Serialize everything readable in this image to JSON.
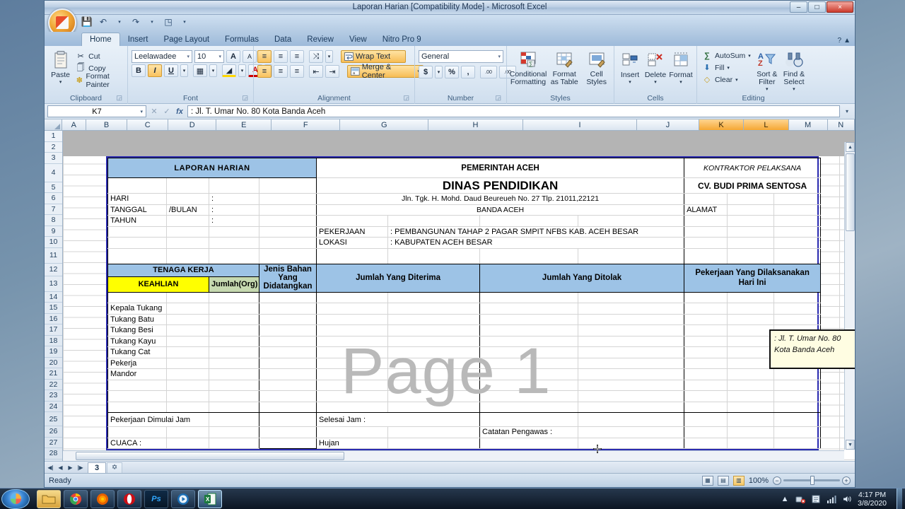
{
  "window": {
    "title": "Laporan Harian  [Compatibility Mode] - Microsoft Excel",
    "minimize": "–",
    "maximize": "□",
    "close": "×",
    "help": "?",
    "ribbon_collapse": "▲"
  },
  "qat": {
    "save": "save-icon",
    "undo": "↶",
    "redo": "↷",
    "print_preview": "◳",
    "customize": "▾"
  },
  "tabs": [
    {
      "label": "Home",
      "active": true
    },
    {
      "label": "Insert",
      "active": false
    },
    {
      "label": "Page Layout",
      "active": false
    },
    {
      "label": "Formulas",
      "active": false
    },
    {
      "label": "Data",
      "active": false
    },
    {
      "label": "Review",
      "active": false
    },
    {
      "label": "View",
      "active": false
    },
    {
      "label": "Nitro Pro 9",
      "active": false
    }
  ],
  "ribbon": {
    "clipboard": {
      "label": "Clipboard",
      "paste": "Paste",
      "cut": "Cut",
      "copy": "Copy",
      "format_painter": "Format Painter",
      "dialog": "◲"
    },
    "font": {
      "label": "Font",
      "family": "Leelawadee",
      "size": "10",
      "grow": "A",
      "shrink": "A",
      "bold": "B",
      "italic": "I",
      "underline": "U",
      "borders": "▦",
      "fill_color": "◢",
      "font_color": "A",
      "dialog": "◲"
    },
    "alignment": {
      "label": "Alignment",
      "align_top": "≡",
      "align_middle": "≡",
      "align_bottom": "≡",
      "orientation": "⤨",
      "align_left": "≡",
      "align_center": "≡",
      "align_right": "≡",
      "decrease_indent": "⇤",
      "increase_indent": "⇥",
      "wrap_text": "Wrap Text",
      "merge_center": "Merge & Center",
      "merge_caret": "▾",
      "dialog": "◲"
    },
    "number": {
      "label": "Number",
      "format": "General",
      "currency": "$",
      "percent": "%",
      "comma": ",",
      "increase_decimal": ".00",
      "decrease_decimal": ".00",
      "dialog": "◲"
    },
    "styles": {
      "label": "Styles",
      "conditional_formatting": "Conditional Formatting",
      "format_as_table": "Format as Table",
      "cell_styles": "Cell Styles"
    },
    "cells": {
      "label": "Cells",
      "insert": "Insert",
      "delete": "Delete",
      "format": "Format"
    },
    "editing": {
      "label": "Editing",
      "autosum": "AutoSum",
      "fill": "Fill",
      "clear": "Clear",
      "sort_filter": "Sort & Filter",
      "find_select": "Find & Select"
    }
  },
  "formula_bar": {
    "name_box": "K7",
    "cancel": "✕",
    "enter": "✓",
    "insert_function": "fx",
    "value": ": Jl. T. Umar No. 80 Kota Banda Aceh",
    "expand": "▾"
  },
  "grid": {
    "columns": [
      "A",
      "B",
      "C",
      "D",
      "E",
      "F",
      "G",
      "H",
      "I",
      "J",
      "K",
      "L",
      "M",
      "N"
    ],
    "selected_columns": [
      "K",
      "L"
    ],
    "rows": [
      "1",
      "2",
      "3",
      "4",
      "5",
      "6",
      "7",
      "8",
      "9",
      "10",
      "11",
      "12",
      "13",
      "14",
      "15",
      "16",
      "17",
      "18",
      "19",
      "20",
      "21",
      "22",
      "23",
      "24",
      "25",
      "26",
      "27",
      "28"
    ],
    "watermark": "Page 1"
  },
  "form": {
    "title": "LAPORAN HARIAN",
    "left": {
      "hari_label": "HARI",
      "hari_sep": ":",
      "tanggal_label": "TANGGAL",
      "bulan_label": "/BULAN",
      "tanggal_sep": ":",
      "tahun_label": "TAHUN",
      "tahun_sep": ":"
    },
    "center": {
      "line1": "PEMERINTAH ACEH",
      "line2": "DINAS PENDIDIKAN",
      "line3": "Jln. Tgk. H. Mohd. Daud Beureueh No. 27 Tlp. 21011,22121",
      "line4": "BANDA ACEH",
      "pekerjaan_label": "PEKERJAAN",
      "pekerjaan_value": ": PEMBANGUNAN TAHAP 2 PAGAR SMPIT NFBS KAB. ACEH BESAR",
      "lokasi_label": "LOKASI",
      "lokasi_value": ": KABUPATEN ACEH BESAR"
    },
    "right": {
      "kontraktor_label": "KONTRAKTOR PELAKSANA",
      "kontraktor_name": "CV. BUDI PRIMA SENTOSA",
      "alamat_label": "ALAMAT",
      "alamat_value": ": Jl. T. Umar No. 80\nKota Banda Aceh"
    },
    "table": {
      "tenaga_kerja": "TENAGA KERJA",
      "keahlian": "KEAHLIAN",
      "jumlah_org": "Jumlah(Org)",
      "jenis_bahan": "Jenis Bahan Yang Didatangkan",
      "jumlah_diterima": "Jumlah Yang Diterima",
      "jumlah_ditolak": "Jumlah Yang Ditolak",
      "pekerjaan_dilaksanakan": "Pekerjaan Yang Dilaksanakan Hari Ini",
      "workers": [
        "Kepala Tukang",
        "Tukang Batu",
        "Tukang Besi",
        "Tukang Kayu",
        "Tukang Cat",
        "Pekerja",
        "Mandor"
      ]
    },
    "footer": {
      "mulai": "Pekerjaan Dimulai  Jam",
      "selesai": "Selesai Jam :",
      "cuaca": "CUACA :",
      "hujan": "Hujan",
      "catatan": "Catatan Pengawas :"
    }
  },
  "sheet_tabs": {
    "first": "⏮",
    "prev": "◀",
    "next": "▶",
    "last": "⏭",
    "active_sheet": "3",
    "insert_sheet": "➕"
  },
  "status_bar": {
    "state": "Ready",
    "view_normal": "▦",
    "view_layout": "▤",
    "view_break": "▥",
    "zoom": "100%",
    "zoom_out": "−",
    "zoom_in": "+"
  },
  "taskbar": {
    "start": "start-orb",
    "items": [
      {
        "name": "file-explorer",
        "glyph": "🗀"
      },
      {
        "name": "google-chrome",
        "glyph": "◉"
      },
      {
        "name": "mozilla-firefox",
        "glyph": "●"
      },
      {
        "name": "opera-browser",
        "glyph": "O"
      },
      {
        "name": "adobe-photoshop",
        "glyph": "Ps"
      },
      {
        "name": "media-player",
        "glyph": "▶"
      },
      {
        "name": "microsoft-excel",
        "glyph": "X"
      }
    ],
    "tray": {
      "show_hidden": "▲",
      "network_error": "✖",
      "action_center": "⚑",
      "signal": "▃",
      "volume": "🔊"
    },
    "time": "4:17 PM",
    "date": "3/8/2020"
  },
  "colors": {
    "header_blue": "#9dc3e6",
    "keahlian_yellow": "#ffff00",
    "jumlah_green": "#c6d9b0",
    "form_border": "#2a2ab0",
    "selection_orange": "#f5a733"
  }
}
